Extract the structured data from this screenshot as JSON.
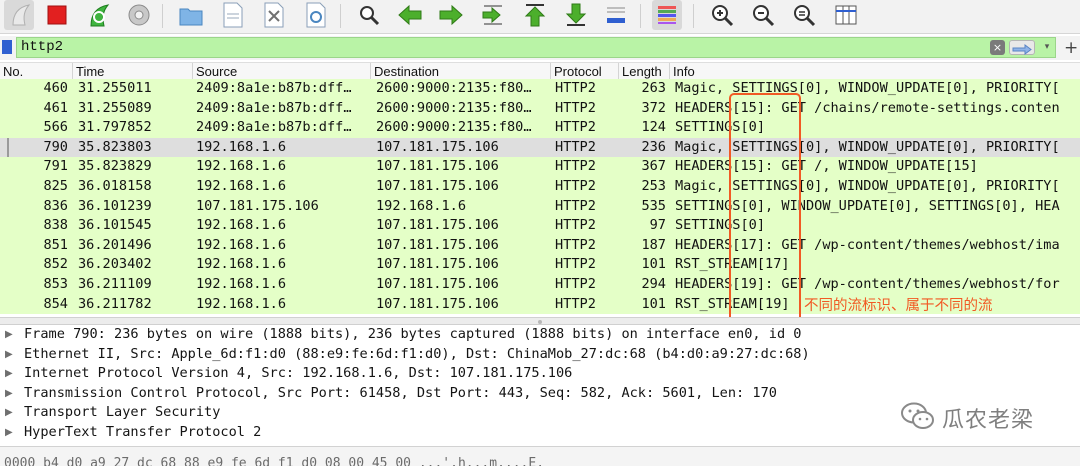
{
  "toolbar": {
    "buttons": [
      "start-capture-icon",
      "stop-capture-icon",
      "restart-capture-icon",
      "capture-options-icon",
      "open-file-icon",
      "save-file-icon",
      "close-file-icon",
      "reload-file-icon",
      "find-packet-icon",
      "go-back-icon",
      "go-forward-icon",
      "go-to-packet-icon",
      "first-packet-icon",
      "last-packet-icon",
      "autoscroll-icon",
      "colorize-icon",
      "zoom-in-icon",
      "zoom-out-icon",
      "normal-size-icon",
      "resize-columns-icon"
    ]
  },
  "filter": {
    "value": "http2",
    "clear_label": "×",
    "dropdown_label": "▾",
    "add_label": "+"
  },
  "columns": [
    "No.",
    "Time",
    "Source",
    "Destination",
    "Protocol",
    "Length",
    "Info"
  ],
  "rows": [
    {
      "no": "460",
      "time": "31.255011",
      "src": "2409:8a1e:b87b:dff…",
      "dst": "2600:9000:2135:f80…",
      "proto": "HTTP2",
      "len": "263",
      "info": "Magic, SETTINGS[0], WINDOW_UPDATE[0], PRIORITY[",
      "selected": false
    },
    {
      "no": "461",
      "time": "31.255089",
      "src": "2409:8a1e:b87b:dff…",
      "dst": "2600:9000:2135:f80…",
      "proto": "HTTP2",
      "len": "372",
      "info": "HEADERS[15]: GET /chains/remote-settings.conten",
      "selected": false
    },
    {
      "no": "566",
      "time": "31.797852",
      "src": "2409:8a1e:b87b:dff…",
      "dst": "2600:9000:2135:f80…",
      "proto": "HTTP2",
      "len": "124",
      "info": "SETTINGS[0]",
      "selected": false
    },
    {
      "no": "790",
      "time": "35.823803",
      "src": "192.168.1.6",
      "dst": "107.181.175.106",
      "proto": "HTTP2",
      "len": "236",
      "info": "Magic, SETTINGS[0], WINDOW_UPDATE[0], PRIORITY[",
      "selected": true
    },
    {
      "no": "791",
      "time": "35.823829",
      "src": "192.168.1.6",
      "dst": "107.181.175.106",
      "proto": "HTTP2",
      "len": "367",
      "info": "HEADERS[15]: GET /, WINDOW_UPDATE[15]",
      "selected": false
    },
    {
      "no": "825",
      "time": "36.018158",
      "src": "192.168.1.6",
      "dst": "107.181.175.106",
      "proto": "HTTP2",
      "len": "253",
      "info": "Magic, SETTINGS[0], WINDOW_UPDATE[0], PRIORITY[",
      "selected": false
    },
    {
      "no": "836",
      "time": "36.101239",
      "src": "107.181.175.106",
      "dst": "192.168.1.6",
      "proto": "HTTP2",
      "len": "535",
      "info": "SETTINGS[0], WINDOW_UPDATE[0], SETTINGS[0], HEA",
      "selected": false
    },
    {
      "no": "838",
      "time": "36.101545",
      "src": "192.168.1.6",
      "dst": "107.181.175.106",
      "proto": "HTTP2",
      "len": "97",
      "info": "SETTINGS[0]",
      "selected": false
    },
    {
      "no": "851",
      "time": "36.201496",
      "src": "192.168.1.6",
      "dst": "107.181.175.106",
      "proto": "HTTP2",
      "len": "187",
      "info": "HEADERS[17]: GET /wp-content/themes/webhost/ima",
      "selected": false
    },
    {
      "no": "852",
      "time": "36.203402",
      "src": "192.168.1.6",
      "dst": "107.181.175.106",
      "proto": "HTTP2",
      "len": "101",
      "info": "RST_STREAM[17]",
      "selected": false
    },
    {
      "no": "853",
      "time": "36.211109",
      "src": "192.168.1.6",
      "dst": "107.181.175.106",
      "proto": "HTTP2",
      "len": "294",
      "info": "HEADERS[19]: GET /wp-content/themes/webhost/for",
      "selected": false
    },
    {
      "no": "854",
      "time": "36.211782",
      "src": "192.168.1.6",
      "dst": "107.181.175.106",
      "proto": "HTTP2",
      "len": "101",
      "info": "RST_STREAM[19]",
      "selected": false
    }
  ],
  "annotation": {
    "text": "不同的流标识、属于不同的流",
    "color": "#f15a24"
  },
  "details": [
    "Frame 790: 236 bytes on wire (1888 bits), 236 bytes captured (1888 bits) on interface en0, id 0",
    "Ethernet II, Src: Apple_6d:f1:d0 (88:e9:fe:6d:f1:d0), Dst: ChinaMob_27:dc:68 (b4:d0:a9:27:dc:68)",
    "Internet Protocol Version 4, Src: 192.168.1.6, Dst: 107.181.175.106",
    "Transmission Control Protocol, Src Port: 61458, Dst Port: 443, Seq: 582, Ack: 5601, Len: 170",
    "Transport Layer Security",
    "HyperText Transfer Protocol 2"
  ],
  "bytes_line": "0000  b4 d0 a9 27 dc 68 88 e9  fe 6d f1 d0 08 00 45 00   ...'.h...m....E.",
  "watermark": {
    "text": "瓜农老梁"
  },
  "colors": {
    "row_bg": "#e4ffc7",
    "selected_bg": "#dedede",
    "filter_bg": "#b9f3a6"
  }
}
